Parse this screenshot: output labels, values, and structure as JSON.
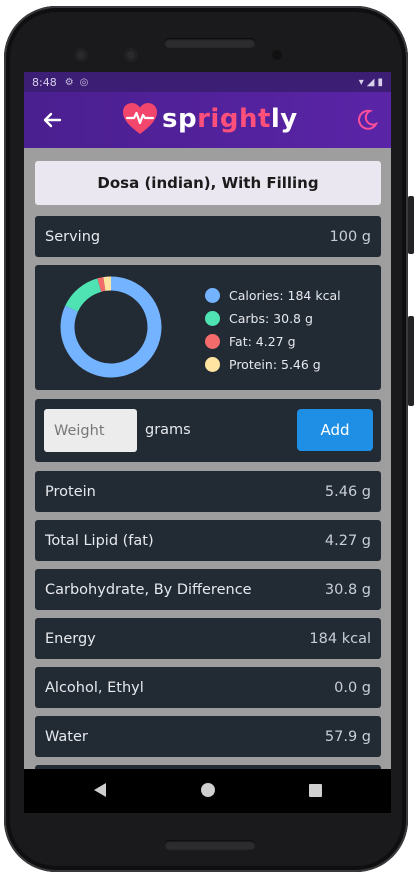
{
  "status_bar": {
    "time": "8:48",
    "icons": [
      "gear-icon",
      "circle-icon",
      "wifi-icon",
      "signal-icon",
      "battery-icon"
    ]
  },
  "app_bar": {
    "back_icon": "arrow-left-icon",
    "brand_prefix": "sp",
    "brand_accent": "right",
    "brand_suffix": "ly",
    "theme_icon": "moon-icon",
    "colors": {
      "bar": "#4a1f8f",
      "accent": "#ff4f7b"
    }
  },
  "food": {
    "title": "Dosa (indian), With Filling",
    "serving_label": "Serving",
    "serving_value": "100 g"
  },
  "chart_data": {
    "type": "pie",
    "donut": true,
    "legend": "right",
    "labels": [
      "Calories: 184 kcal",
      "Carbs: 30.8 g",
      "Fat: 4.27 g",
      "Protein: 5.46 g"
    ],
    "values": [
      184,
      30.8,
      4.27,
      5.46
    ],
    "colors": [
      "#74b3ff",
      "#4fe3b3",
      "#f46b6b",
      "#ffe3a0"
    ]
  },
  "add_form": {
    "weight_placeholder": "Weight",
    "unit_label": "grams",
    "add_label": "Add"
  },
  "nutrients": [
    {
      "label": "Protein",
      "value": "5.46 g"
    },
    {
      "label": "Total Lipid (fat)",
      "value": "4.27 g"
    },
    {
      "label": "Carbohydrate, By Difference",
      "value": "30.8 g"
    },
    {
      "label": "Energy",
      "value": "184 kcal"
    },
    {
      "label": "Alcohol, Ethyl",
      "value": "0.0 g"
    },
    {
      "label": "Water",
      "value": "57.9 g"
    }
  ],
  "nav_bar": {
    "icons": [
      "nav-back-icon",
      "nav-home-icon",
      "nav-recents-icon"
    ]
  }
}
